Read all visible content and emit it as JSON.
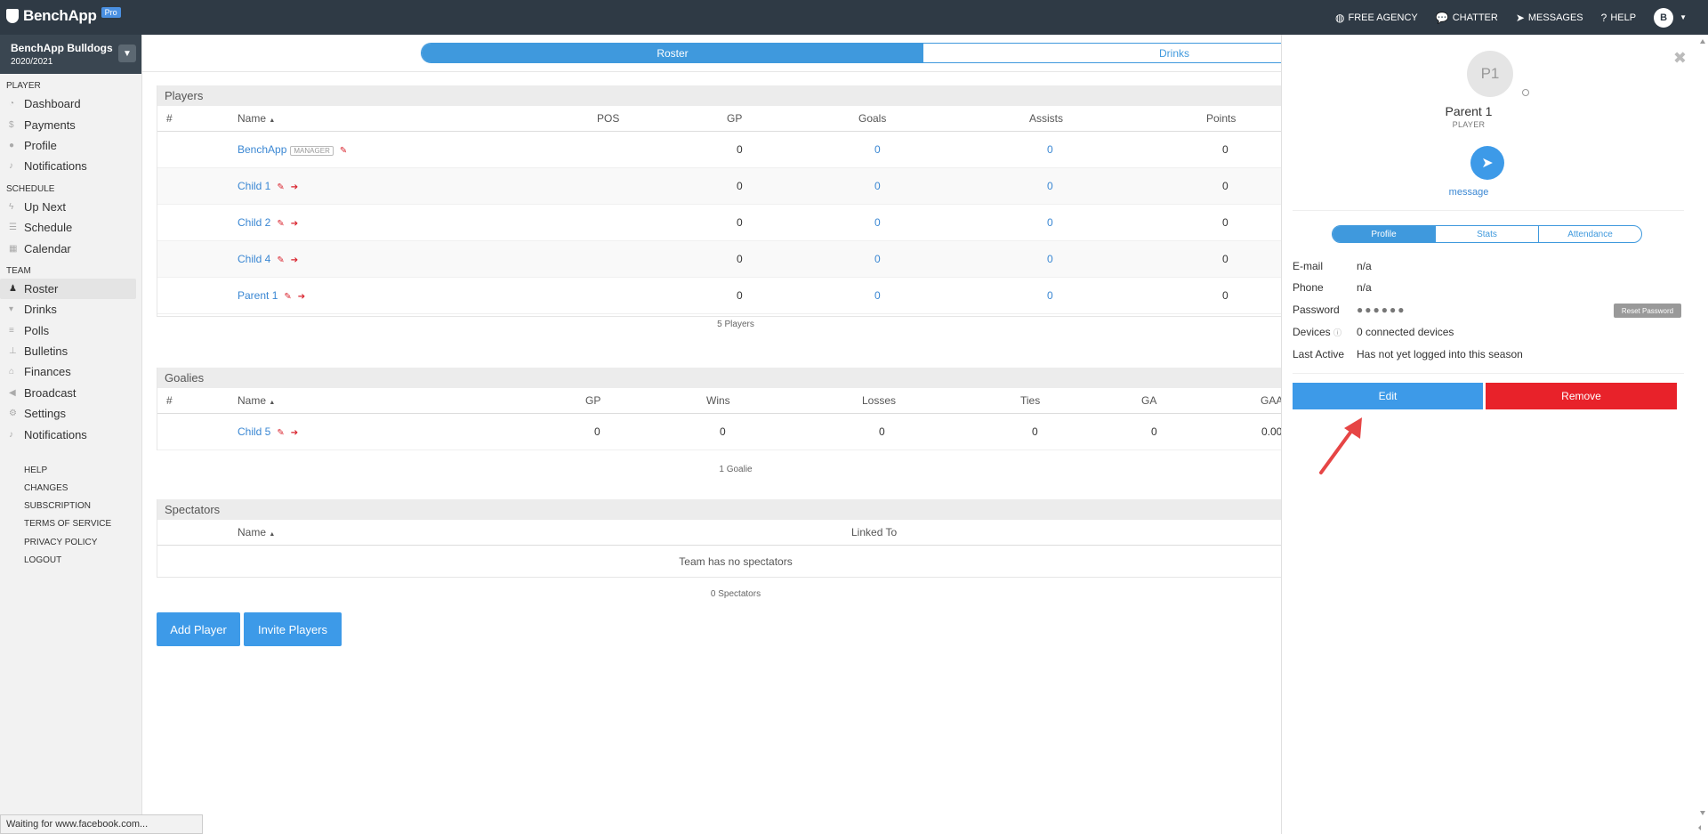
{
  "app": {
    "name": "BenchApp",
    "badge": "Pro"
  },
  "topnav": {
    "free_agency": "FREE AGENCY",
    "chatter": "CHATTER",
    "messages": "MESSAGES",
    "help": "HELP",
    "user_initial": "B"
  },
  "team": {
    "name": "BenchApp Bulldogs",
    "season": "2020/2021"
  },
  "sidebar": {
    "player_section": "PLAYER",
    "player_items": [
      "Dashboard",
      "Payments",
      "Profile",
      "Notifications"
    ],
    "schedule_section": "SCHEDULE",
    "schedule_items": [
      "Up Next",
      "Schedule",
      "Calendar"
    ],
    "team_section": "TEAM",
    "team_items": [
      "Roster",
      "Drinks",
      "Polls",
      "Bulletins",
      "Finances",
      "Broadcast",
      "Settings",
      "Notifications"
    ],
    "links": [
      "HELP",
      "CHANGES",
      "SUBSCRIPTION",
      "TERMS OF SERVICE",
      "PRIVACY POLICY",
      "LOGOUT"
    ]
  },
  "tabs": {
    "roster": "Roster",
    "drinks": "Drinks"
  },
  "players": {
    "title": "Players",
    "headers": {
      "num": "#",
      "name": "Name",
      "pos": "POS",
      "gp": "GP",
      "goals": "Goals",
      "assists": "Assists",
      "points": "Points"
    },
    "rows": [
      {
        "name": "BenchApp",
        "tag": "MANAGER",
        "gp": "0",
        "goals": "0",
        "assists": "0",
        "points": "0"
      },
      {
        "name": "Child 1",
        "gp": "0",
        "goals": "0",
        "assists": "0",
        "points": "0"
      },
      {
        "name": "Child 2",
        "gp": "0",
        "goals": "0",
        "assists": "0",
        "points": "0"
      },
      {
        "name": "Child 4",
        "gp": "0",
        "goals": "0",
        "assists": "0",
        "points": "0"
      },
      {
        "name": "Parent 1",
        "gp": "0",
        "goals": "0",
        "assists": "0",
        "points": "0"
      }
    ],
    "footer": "5 Players"
  },
  "goalies": {
    "title": "Goalies",
    "headers": {
      "num": "#",
      "name": "Name",
      "gp": "GP",
      "wins": "Wins",
      "losses": "Losses",
      "ties": "Ties",
      "ga": "GA",
      "gaa": "GAA"
    },
    "rows": [
      {
        "name": "Child 5",
        "gp": "0",
        "wins": "0",
        "losses": "0",
        "ties": "0",
        "ga": "0",
        "gaa": "0.00"
      }
    ],
    "footer": "1 Goalie"
  },
  "spectators": {
    "title": "Spectators",
    "headers": {
      "name": "Name",
      "linked_to": "Linked To"
    },
    "empty": "Team has no spectators",
    "footer": "0 Spectators"
  },
  "buttons": {
    "add_player": "Add Player",
    "invite_players": "Invite Players"
  },
  "profile_panel": {
    "initials": "P1",
    "name": "Parent 1",
    "role": "PLAYER",
    "message_label": "message",
    "tabs": [
      "Profile",
      "Stats",
      "Attendance"
    ],
    "email_label": "E-mail",
    "email_value": "n/a",
    "phone_label": "Phone",
    "phone_value": "n/a",
    "password_label": "Password",
    "password_value": "●●●●●●",
    "reset_password": "Reset Password",
    "devices_label": "Devices",
    "devices_value": "0 connected devices",
    "last_active_label": "Last Active",
    "last_active_value": "Has not yet logged into this season",
    "edit": "Edit",
    "remove": "Remove"
  },
  "status_bar": "Waiting for www.facebook.com...",
  "colors": {
    "accent": "#3d9ae8",
    "danger": "#e8222a",
    "topbar": "#2f3a45"
  }
}
